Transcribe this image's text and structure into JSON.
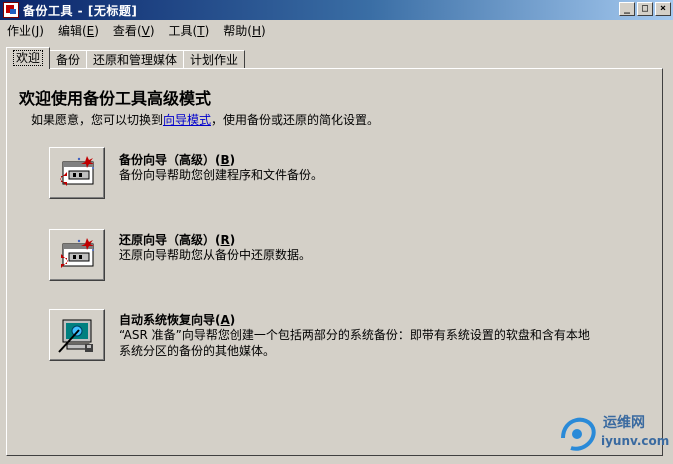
{
  "window": {
    "title": "备份工具 - [无标题]",
    "controls": [
      "_",
      "□",
      "×"
    ]
  },
  "menu": [
    {
      "label": "作业",
      "acc": "J"
    },
    {
      "label": "编辑",
      "acc": "E"
    },
    {
      "label": "查看",
      "acc": "V"
    },
    {
      "label": "工具",
      "acc": "T"
    },
    {
      "label": "帮助",
      "acc": "H"
    }
  ],
  "tabs": [
    "欢迎",
    "备份",
    "还原和管理媒体",
    "计划作业"
  ],
  "welcome": {
    "heading": "欢迎使用备份工具高级模式",
    "intro_before": "如果愿意，您可以切换到",
    "intro_link": "向导模式",
    "intro_after": "，使用备份或还原的简化设置。"
  },
  "wizards": [
    {
      "title": "备份向导（高级）",
      "acc": "B",
      "desc": [
        "备份向导帮助您创建程序和文件备份。"
      ],
      "icon": "backup-wizard-icon"
    },
    {
      "title": "还原向导（高级）",
      "acc": "R",
      "desc": [
        "还原向导帮助您从备份中还原数据。"
      ],
      "icon": "restore-wizard-icon"
    },
    {
      "title": "自动系统恢复向导",
      "acc": "A",
      "desc": [
        "“ASR 准备”向导帮您创建一个包括两部分的系统备份：即带有系统设置的软盘和含有本地",
        "系统分区的备份的其他媒体。"
      ],
      "icon": "asr-wizard-icon"
    }
  ],
  "watermark": {
    "name": "运维网",
    "url": "iyunv.com"
  }
}
